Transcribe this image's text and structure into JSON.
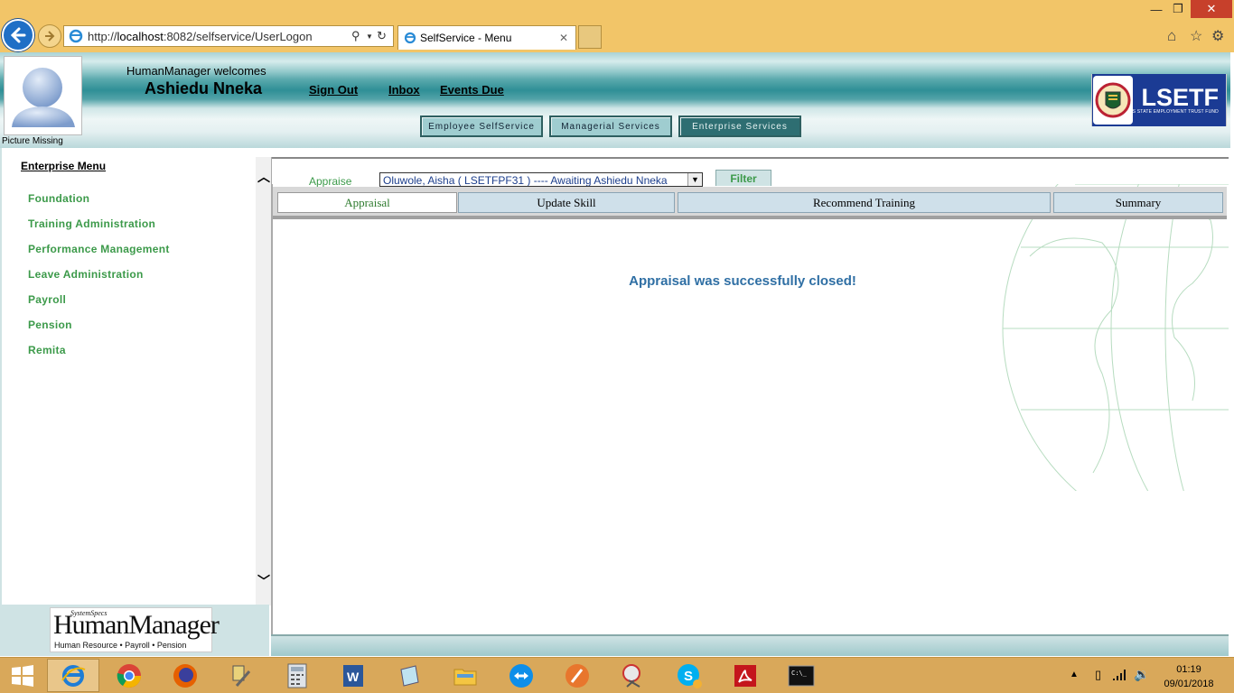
{
  "browser": {
    "url_prefix": "http://",
    "url_host": "localhost",
    "url_rest": ":8082/selfservice/UserLogon",
    "tab_title": "SelfService - Menu"
  },
  "header": {
    "welcome_text": "HumanManager welcomes",
    "user_name": "Ashiedu Nneka",
    "photo_caption": "Picture Missing",
    "links": [
      "Sign Out",
      "Inbox",
      "Events Due"
    ],
    "services": [
      "Employee SelfService",
      "Managerial Services",
      "Enterprise Services"
    ],
    "logo_text": "LSETF",
    "logo_subtext": "LAGOS STATE EMPLOYMENT TRUST FUND"
  },
  "sidebar": {
    "title": "Enterprise Menu",
    "items": [
      "Foundation",
      "Training Administration",
      "Performance Management",
      "Leave Administration",
      "Payroll",
      "Pension",
      "Remita"
    ],
    "footer_logo": {
      "brand": "SystemSpecs",
      "name": "HumanManager",
      "tagline": "Human Resource • Payroll • Pension"
    }
  },
  "main": {
    "appraise_label": "Appraise",
    "appraise_value": "Oluwole, Aisha ( LSETFPF31 ) ---- Awaiting Ashiedu Nneka",
    "filter_label": "Filter",
    "tabs": [
      "Appraisal",
      "Update Skill",
      "Recommend Training",
      "Summary"
    ],
    "active_tab": "Appraisal",
    "message": "Appraisal was successfully closed!"
  },
  "taskbar": {
    "time": "01:19",
    "date": "09/01/2018"
  },
  "colors": {
    "menu_green": "#3c9a4a",
    "message_blue": "#2f6fa4",
    "header_teal": "#2f8f96",
    "taskbar": "#d9a85a"
  }
}
